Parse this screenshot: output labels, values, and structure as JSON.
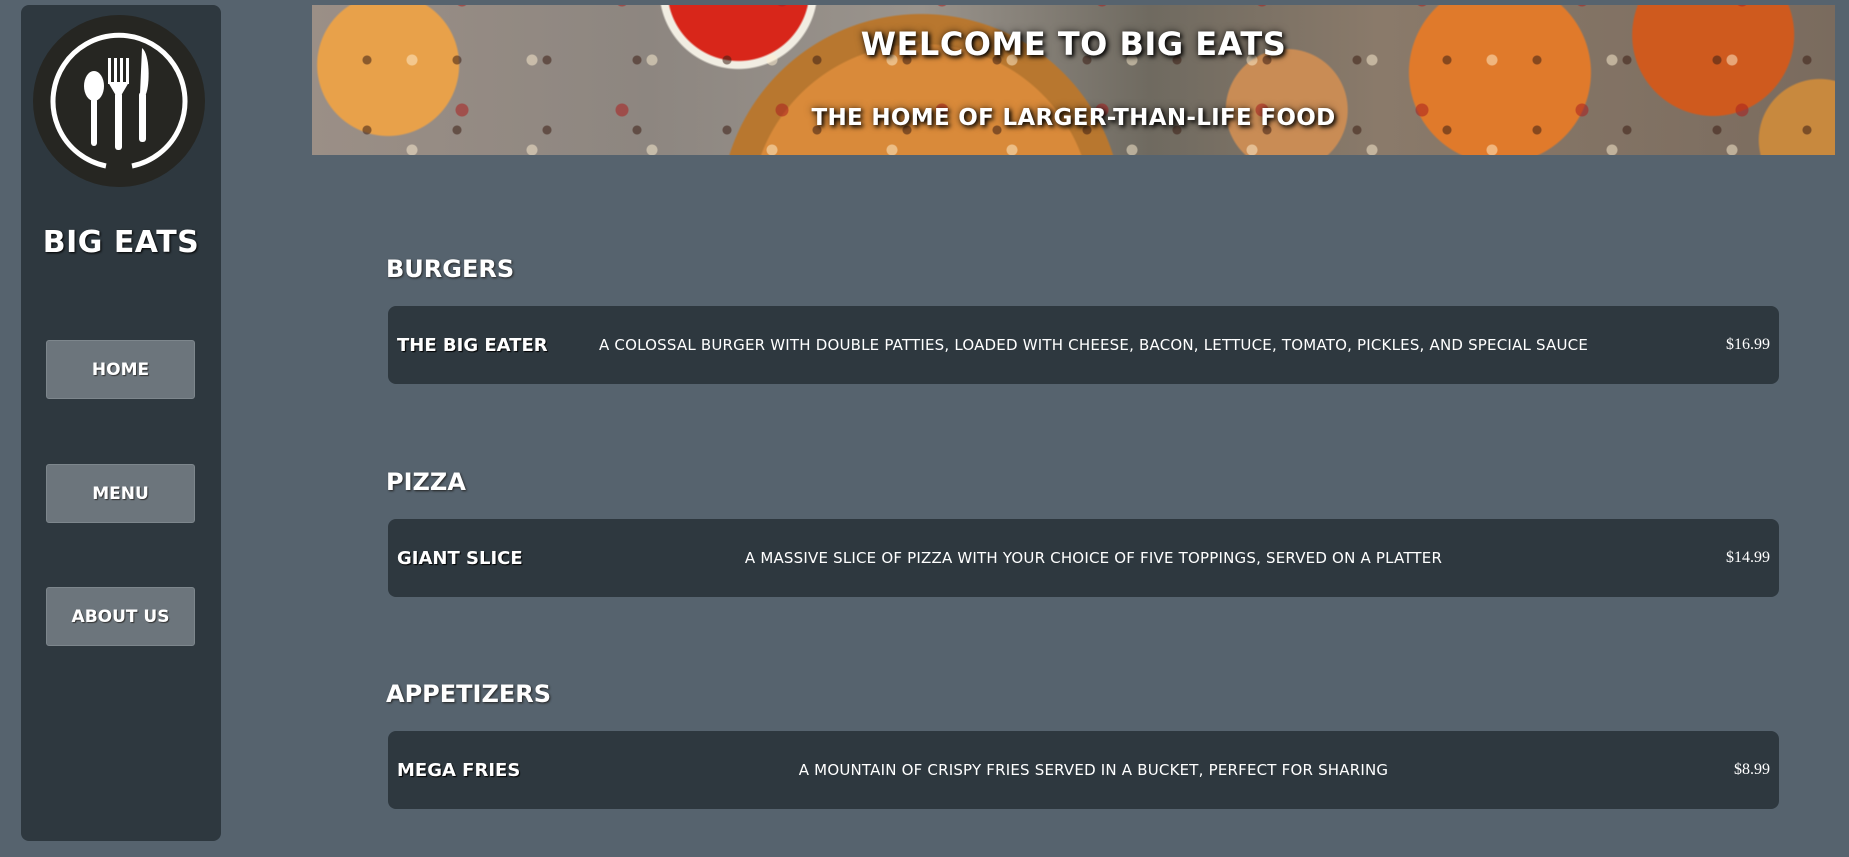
{
  "sidebar": {
    "brand": "BIG EATS",
    "logo_icon": "fork-knife-spoon-icon",
    "nav": [
      {
        "label": "HOME"
      },
      {
        "label": "MENU"
      },
      {
        "label": "ABOUT US"
      }
    ]
  },
  "banner": {
    "title": "WELCOME TO BIG EATS",
    "subtitle": "THE HOME OF LARGER-THAN-LIFE FOOD"
  },
  "menu": {
    "sections": [
      {
        "title": "BURGERS",
        "items": [
          {
            "name": "THE BIG EATER",
            "description": "A COLOSSAL BURGER WITH DOUBLE PATTIES, LOADED WITH CHEESE, BACON, LETTUCE, TOMATO, PICKLES, AND SPECIAL SAUCE",
            "price": "$16.99"
          }
        ]
      },
      {
        "title": "PIZZA",
        "items": [
          {
            "name": "GIANT SLICE",
            "description": "A MASSIVE SLICE OF PIZZA WITH YOUR CHOICE OF FIVE TOPPINGS, SERVED ON A PLATTER",
            "price": "$14.99"
          }
        ]
      },
      {
        "title": "APPETIZERS",
        "items": [
          {
            "name": "MEGA FRIES",
            "description": "A MOUNTAIN OF CRISPY FRIES SERVED IN A BUCKET, PERFECT FOR SHARING",
            "price": "$8.99"
          }
        ]
      }
    ]
  },
  "colors": {
    "background": "#56636e",
    "panel": "#2e383f",
    "button": "#6c757c",
    "text": "#ffffff"
  }
}
